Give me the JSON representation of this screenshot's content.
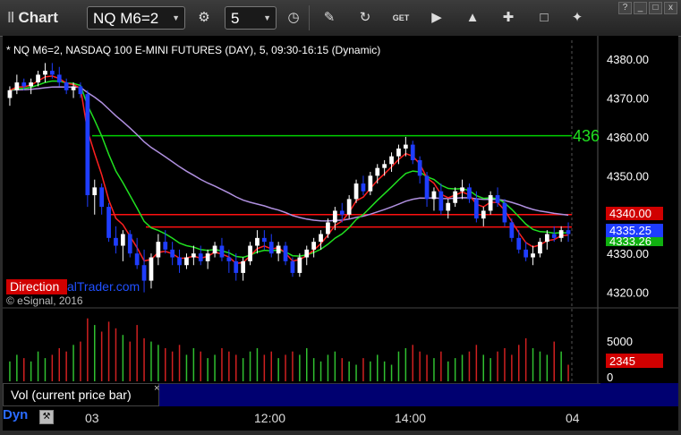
{
  "toolbar": {
    "title": "Chart",
    "symbol": "NQ M6=2",
    "interval": "5",
    "icons": [
      "settings-icon",
      "clock-icon",
      "pencil-icon",
      "refresh-icon",
      "get-icon",
      "play-icon",
      "alert-icon",
      "cursor-icon",
      "comment-icon",
      "twitter-icon"
    ]
  },
  "window": {
    "buttons": [
      "?",
      "_",
      "□",
      "x"
    ]
  },
  "chart_header": "* NQ M6=2, NASDAQ 100 E-MINI FUTURES (DAY), 5, 09:30-16:15 (Dynamic)",
  "watermark": {
    "brand_red": "Direction",
    "brand_blue": "alTrader.com",
    "copyright": "© eSignal, 2016"
  },
  "price_axis": [
    "4380.00",
    "4370.00",
    "4360.00",
    "4350.00",
    "4340.00",
    "4330.00",
    "4320.00"
  ],
  "price_labels": {
    "green_line_label": "436",
    "red_line": "4340.00",
    "last_price": "4335.25",
    "green_ma": "4333.26"
  },
  "volume": {
    "title": "Vol (current price bar)",
    "close": "×",
    "axis": [
      "5000",
      "0"
    ],
    "current": "2345"
  },
  "time_axis": [
    "03",
    "12:00",
    "14:00",
    "04"
  ],
  "bottom": {
    "label": "Dyn"
  },
  "colors": {
    "bull": "#ffffff",
    "bear": "#1f3dff",
    "red_ma": "#ff2020",
    "green_ma": "#20e020",
    "purple_ma": "#b090e0",
    "green_level": "#00d000",
    "red_level": "#ff1010"
  },
  "chart_data": {
    "type": "candlestick",
    "ylim": [
      4316,
      4386
    ],
    "levels": [
      {
        "value": 4360.3,
        "color": "green"
      },
      {
        "value": 4340.0,
        "color": "red"
      },
      {
        "value": 4336.8,
        "color": "red"
      }
    ],
    "candles": [
      [
        4370,
        4373,
        4368,
        4372
      ],
      [
        4372,
        4376,
        4371,
        4374
      ],
      [
        4374,
        4375,
        4372,
        4373
      ],
      [
        4373,
        4375,
        4371,
        4374
      ],
      [
        4374,
        4377,
        4373,
        4376
      ],
      [
        4376,
        4379,
        4374,
        4377
      ],
      [
        4377,
        4379,
        4375,
        4376
      ],
      [
        4376,
        4378,
        4373,
        4374
      ],
      [
        4374,
        4375,
        4371,
        4372
      ],
      [
        4372,
        4374,
        4370,
        4373
      ],
      [
        4373,
        4374,
        4370,
        4371
      ],
      [
        4371,
        4372,
        4342,
        4345
      ],
      [
        4345,
        4349,
        4340,
        4347
      ],
      [
        4347,
        4348,
        4340,
        4342
      ],
      [
        4342,
        4343,
        4333,
        4334
      ],
      [
        4334,
        4337,
        4330,
        4332
      ],
      [
        4332,
        4336,
        4328,
        4335
      ],
      [
        4335,
        4336,
        4329,
        4330
      ],
      [
        4330,
        4334,
        4326,
        4327
      ],
      [
        4327,
        4331,
        4320,
        4323
      ],
      [
        4323,
        4330,
        4321,
        4329
      ],
      [
        4329,
        4335,
        4327,
        4333
      ],
      [
        4333,
        4336,
        4330,
        4331
      ],
      [
        4331,
        4333,
        4327,
        4329
      ],
      [
        4329,
        4331,
        4325,
        4327
      ],
      [
        4327,
        4330,
        4326,
        4329
      ],
      [
        4329,
        4332,
        4327,
        4330
      ],
      [
        4330,
        4332,
        4327,
        4328
      ],
      [
        4328,
        4331,
        4326,
        4330
      ],
      [
        4330,
        4333,
        4329,
        4332
      ],
      [
        4332,
        4334,
        4328,
        4329
      ],
      [
        4329,
        4331,
        4325,
        4328
      ],
      [
        4328,
        4330,
        4323,
        4325
      ],
      [
        4325,
        4329,
        4323,
        4328
      ],
      [
        4328,
        4333,
        4327,
        4332
      ],
      [
        4332,
        4336,
        4330,
        4334
      ],
      [
        4334,
        4336,
        4331,
        4333
      ],
      [
        4333,
        4335,
        4329,
        4330
      ],
      [
        4330,
        4333,
        4328,
        4332
      ],
      [
        4332,
        4333,
        4327,
        4328
      ],
      [
        4328,
        4329,
        4324,
        4325
      ],
      [
        4325,
        4330,
        4324,
        4329
      ],
      [
        4329,
        4332,
        4327,
        4331
      ],
      [
        4331,
        4334,
        4329,
        4333
      ],
      [
        4333,
        4336,
        4331,
        4335
      ],
      [
        4335,
        4339,
        4334,
        4338
      ],
      [
        4338,
        4342,
        4336,
        4341
      ],
      [
        4341,
        4343,
        4338,
        4340
      ],
      [
        4340,
        4345,
        4339,
        4344
      ],
      [
        4344,
        4349,
        4343,
        4348
      ],
      [
        4348,
        4350,
        4345,
        4346
      ],
      [
        4346,
        4351,
        4345,
        4350
      ],
      [
        4350,
        4353,
        4348,
        4352
      ],
      [
        4352,
        4354,
        4350,
        4353
      ],
      [
        4353,
        4356,
        4351,
        4355
      ],
      [
        4355,
        4358,
        4353,
        4357
      ],
      [
        4357,
        4360,
        4355,
        4358
      ],
      [
        4358,
        4359,
        4353,
        4354
      ],
      [
        4354,
        4355,
        4348,
        4350
      ],
      [
        4350,
        4351,
        4342,
        4344
      ],
      [
        4344,
        4347,
        4341,
        4346
      ],
      [
        4346,
        4348,
        4340,
        4341
      ],
      [
        4341,
        4344,
        4339,
        4343
      ],
      [
        4343,
        4347,
        4342,
        4346
      ],
      [
        4346,
        4349,
        4344,
        4347
      ],
      [
        4347,
        4348,
        4343,
        4344
      ],
      [
        4344,
        4346,
        4338,
        4339
      ],
      [
        4339,
        4342,
        4337,
        4341
      ],
      [
        4341,
        4346,
        4340,
        4345
      ],
      [
        4345,
        4347,
        4342,
        4343
      ],
      [
        4343,
        4344,
        4337,
        4338
      ],
      [
        4338,
        4339,
        4333,
        4334
      ],
      [
        4334,
        4336,
        4330,
        4331
      ],
      [
        4331,
        4333,
        4328,
        4329
      ],
      [
        4329,
        4332,
        4327,
        4330
      ],
      [
        4330,
        4334,
        4329,
        4333
      ],
      [
        4333,
        4336,
        4331,
        4335
      ],
      [
        4335,
        4337,
        4333,
        4334
      ],
      [
        4334,
        4337,
        4333,
        4336
      ],
      [
        4336,
        4338,
        4333,
        4335
      ]
    ],
    "volumes": [
      30,
      40,
      35,
      30,
      45,
      35,
      40,
      50,
      45,
      55,
      60,
      95,
      85,
      75,
      90,
      80,
      70,
      60,
      85,
      65,
      60,
      55,
      50,
      45,
      55,
      40,
      50,
      45,
      35,
      40,
      50,
      45,
      40,
      35,
      45,
      50,
      40,
      45,
      35,
      40,
      45,
      40,
      50,
      35,
      30,
      40,
      45,
      35,
      30,
      25,
      35,
      30,
      40,
      30,
      25,
      45,
      50,
      55,
      45,
      40,
      35,
      45,
      30,
      35,
      40,
      45,
      55,
      40,
      35,
      45,
      50,
      40,
      55,
      65,
      50,
      45,
      40,
      60,
      45,
      25
    ]
  }
}
